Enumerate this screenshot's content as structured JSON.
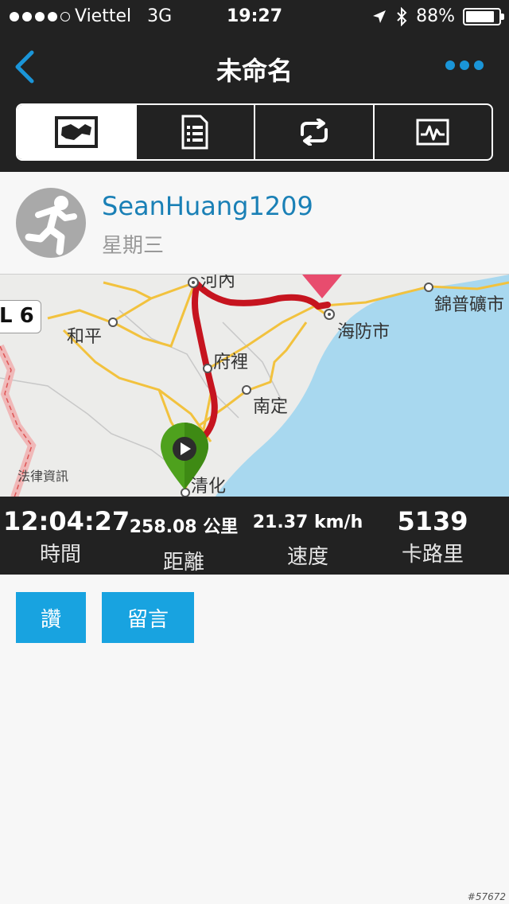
{
  "status_bar": {
    "carrier": "Viettel",
    "network": "3G",
    "time": "19:27",
    "battery": "88%",
    "battery_level": 0.88
  },
  "nav": {
    "title": "未命名",
    "back_icon": "chevron-left-icon",
    "more_icon": "more-dots-icon"
  },
  "tabs": [
    {
      "icon": "map-icon",
      "active": true
    },
    {
      "icon": "list-document-icon",
      "active": false
    },
    {
      "icon": "repeat-icon",
      "active": false
    },
    {
      "icon": "activity-chart-icon",
      "active": false
    }
  ],
  "activity": {
    "username": "SeanHuang1209",
    "weekday": "星期三"
  },
  "map": {
    "labels": {
      "hoa_binh": "和平",
      "phu_ly": "府裡",
      "nam_dinh": "南定",
      "hai_phong": "海防市",
      "cam_pha": "錦普礦市",
      "thanh_hoa": "清化",
      "partial_top": "河內"
    },
    "zoom_badge": "L 6",
    "legal": "法律資訊"
  },
  "stats": [
    {
      "value": "12:04:27",
      "label": "時間"
    },
    {
      "value": "258.08 公里",
      "label": "距離"
    },
    {
      "value": "21.37 km/h",
      "label": "速度"
    },
    {
      "value": "5139",
      "label": "卡路里"
    }
  ],
  "actions": {
    "like": "讚",
    "comment": "留言"
  },
  "watermark": "#57672",
  "colors": {
    "accent": "#1a95d8",
    "button": "#18a3e0",
    "route": "#c6141f",
    "start_pin": "#4ea11d",
    "water": "#a8d8ef"
  }
}
